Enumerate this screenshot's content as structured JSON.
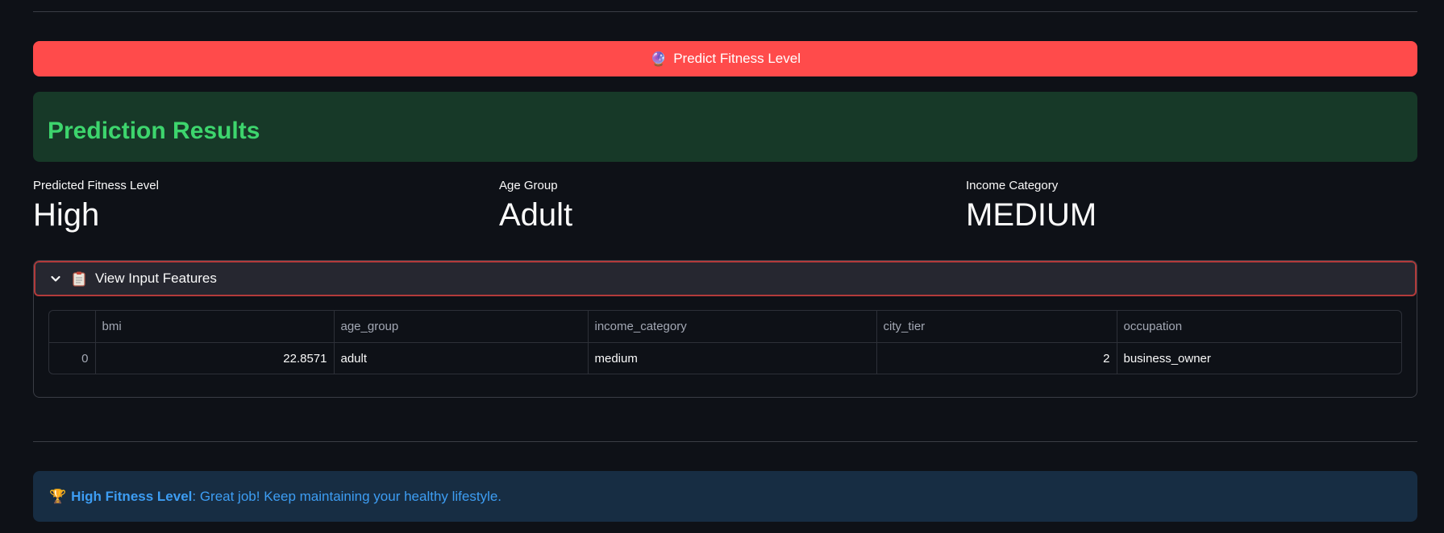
{
  "predict_button": {
    "icon": "crystal-ball-icon",
    "label": "Predict Fitness Level"
  },
  "results": {
    "heading": "Prediction Results",
    "heading_color": "#3dd56d",
    "box_color": "#173928"
  },
  "metrics": [
    {
      "label": "Predicted Fitness Level",
      "value": "High"
    },
    {
      "label": "Age Group",
      "value": "Adult"
    },
    {
      "label": "Income Category",
      "value": "MEDIUM"
    }
  ],
  "expander": {
    "chevron_icon": "chevron-down-icon",
    "icon": "clipboard-icon",
    "title": "View Input Features",
    "expanded": true
  },
  "table": {
    "columns": [
      "",
      "bmi",
      "age_group",
      "income_category",
      "city_tier",
      "occupation"
    ],
    "rows": [
      [
        "0",
        "22.8571",
        "adult",
        "medium",
        "2",
        "business_owner"
      ]
    ]
  },
  "info": {
    "icon": "trophy-icon",
    "bold": "High Fitness Level",
    "text": ": Great job! Keep maintaining your healthy lifestyle.",
    "color": "#3d9df3"
  },
  "colors": {
    "background": "#0e1117",
    "primary_button": "#ff4b4b",
    "info_background": "#172d43"
  }
}
